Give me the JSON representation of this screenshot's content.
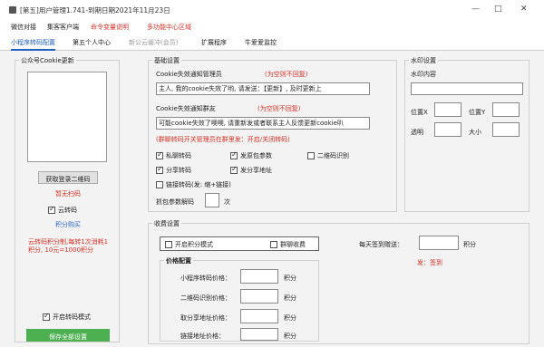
{
  "window": {
    "title": "[第五]用户管理1.741-到期日期2021年11月23日",
    "minimize": "—",
    "maximize": "□",
    "close": "✕"
  },
  "menu": {
    "items": [
      "微信对接",
      "集客客户端",
      "命令变量说明",
      "多功能中心区域"
    ]
  },
  "tabs": [
    "小程序转码配置",
    "第五个人中心",
    "新公云缓冲(会员)",
    "扩展程序",
    "牛爱爱监控"
  ],
  "left": {
    "group_label": "公众号Cookie更新",
    "get_qr_button": "获取登录二维码",
    "status": "暂无扫码",
    "cloud_convert": "云转码",
    "points_buy": "积分购买",
    "note": "云转码积分制,每转1次消耗1积分, 10元=1000积分",
    "enable_mode": "开启转码模式",
    "save_button": "保存全部设置"
  },
  "basic": {
    "group_label": "基础设置",
    "cookie_admin_label": "Cookie失效通知管理员",
    "cookie_admin_hint": "(为空则不回复)",
    "cookie_admin_value": "主人, 我的cookie失效了哟, 请发送：【更新】, 及时更新上",
    "cookie_friend_label": "Cookie失效通知群友",
    "cookie_friend_hint": "(为空则不回复)",
    "cookie_friend_value": "可能cookie失效了噢噢, 请重新发或者联系主人反馈更新cookie叭",
    "note": "(群聊转码开关管理员在群里发：开启/关闭转码)",
    "checks": [
      {
        "label": "私聊转码",
        "on": true
      },
      {
        "label": "发原包参数",
        "on": true
      },
      {
        "label": "二维码识别",
        "on": false
      },
      {
        "label": "分享转码",
        "on": true
      },
      {
        "label": "发分享地址",
        "on": true
      },
      {
        "label": "链接转码(发: 缩+链接)",
        "on": false
      }
    ],
    "decode_label": "抓包参数解码",
    "decode_unit": "次"
  },
  "watermark": {
    "group_label": "水印设置",
    "content_label": "水印内容",
    "pos_x": "位置X",
    "pos_y": "位置Y",
    "opacity": "透明",
    "size": "大小"
  },
  "fees": {
    "group_label": "收费设置",
    "enable_points": "开启积分模式",
    "group_fee": "群聊收费",
    "daily_sign": "每天签到赠送：",
    "points_unit": "积分",
    "sign_hint": "发：签到",
    "price_label": "价格配置",
    "prices": [
      "小程序转码价格：",
      "二维码识别价格：",
      "取分享地址价格：",
      "链接地址价格："
    ],
    "unit": "积分"
  }
}
